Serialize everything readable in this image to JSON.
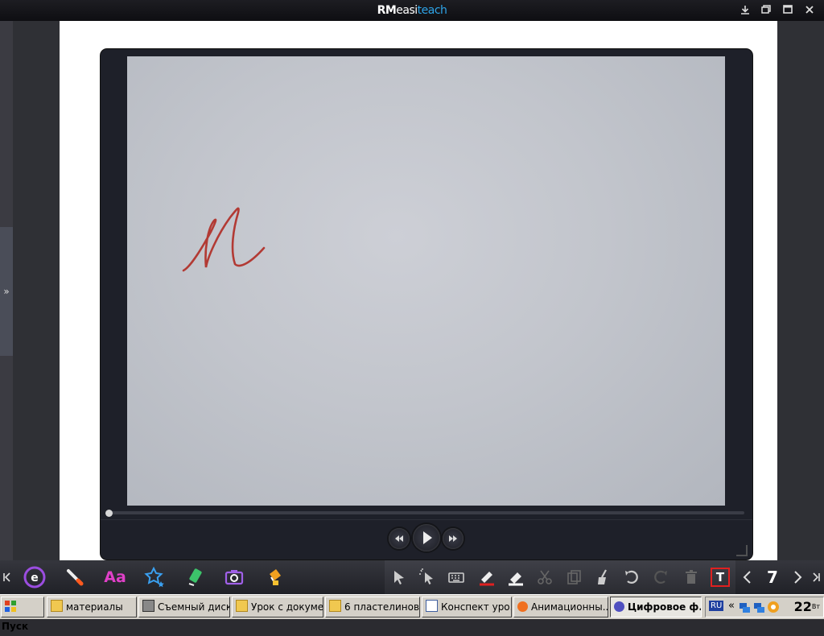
{
  "titlebar": {
    "title_bold": "RM",
    "title_main": "easi",
    "title_accent": "teach",
    "controls": [
      "download-icon",
      "restore-icon",
      "maximize-icon",
      "close-icon"
    ]
  },
  "video": {
    "progress": 0.0,
    "handwriting": "М"
  },
  "toolbar": {
    "page_number": "7",
    "left_icons": [
      "easiteach-logo-icon",
      "brush-icon",
      "text-aa-icon",
      "star-icon",
      "highlighter-icon",
      "camera-icon",
      "fill-bucket-icon"
    ],
    "right_icons": [
      "select-arrow-icon",
      "magic-select-icon",
      "keyboard-icon",
      "pen-icon",
      "eraser-icon",
      "scissors-icon",
      "copy-icon",
      "broom-icon",
      "undo-icon",
      "redo-icon",
      "trash-icon",
      "text-tool-icon",
      "prev-page-icon",
      "next-page-icon",
      "end-icon"
    ],
    "text_aa": "Aa",
    "text_t": "T"
  },
  "taskbar": {
    "start_label": "Пуск",
    "tasks": [
      {
        "label": "материалы"
      },
      {
        "label": "Съемный диск..."
      },
      {
        "label": "Урок с докуме..."
      },
      {
        "label": "6 пластелинов..."
      },
      {
        "label": "Конспект уро..."
      },
      {
        "label": "Анимационны..."
      },
      {
        "label": "Цифровое ф..."
      }
    ],
    "lang": "RU",
    "clock": "22",
    "clock_sub": "Вт"
  },
  "colors": {
    "accent": "#2ea4e8",
    "handwriting": "#b23a34",
    "text_tool_border": "#e02020"
  }
}
